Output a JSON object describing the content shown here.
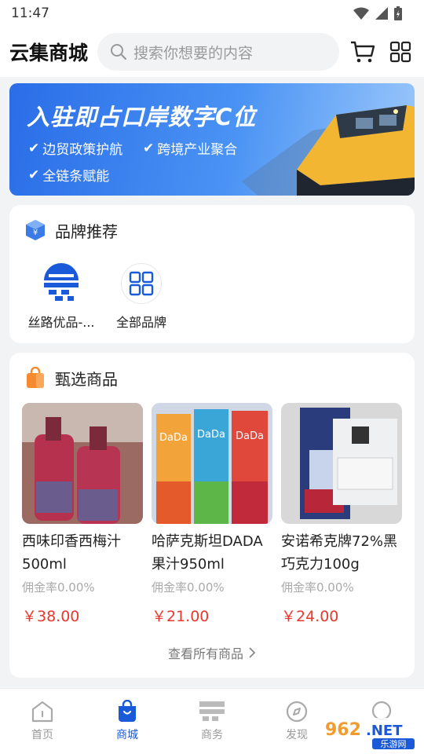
{
  "status_bar": {
    "time": "11:47"
  },
  "header": {
    "title": "云集商城",
    "search_placeholder": "搜索你想要的内容",
    "cart_icon": "cart-icon",
    "apps_icon": "grid-icon"
  },
  "banner": {
    "title": "入驻即占口岸数字C位",
    "items": [
      "边贸政策护航",
      "跨境产业聚合",
      "全链条赋能"
    ]
  },
  "brands": {
    "title": "品牌推荐",
    "items": [
      {
        "label": "丝路优品-..."
      },
      {
        "label": "全部品牌"
      }
    ]
  },
  "products": {
    "title": "甄选商品",
    "items": [
      {
        "name": "西味印香西梅汁500ml",
        "commission": "佣金率0.00%",
        "price": "￥38.00"
      },
      {
        "name": "哈萨克斯坦DADA果汁950ml",
        "commission": "佣金率0.00%",
        "price": "￥21.00"
      },
      {
        "name": "安诺希克牌72%黑巧克力100g",
        "commission": "佣金率0.00%",
        "price": "￥24.00"
      }
    ],
    "view_all": "查看所有商品"
  },
  "tabbar": {
    "items": [
      {
        "label": "首页"
      },
      {
        "label": "商城"
      },
      {
        "label": "商务"
      },
      {
        "label": "发现"
      },
      {
        "label": ""
      }
    ],
    "active_index": 1
  },
  "watermark": {
    "text": "962.NET",
    "sub": "乐游网"
  },
  "colors": {
    "accent": "#1a5ad8",
    "price": "#e8382e",
    "banner": "#2a6de8"
  }
}
